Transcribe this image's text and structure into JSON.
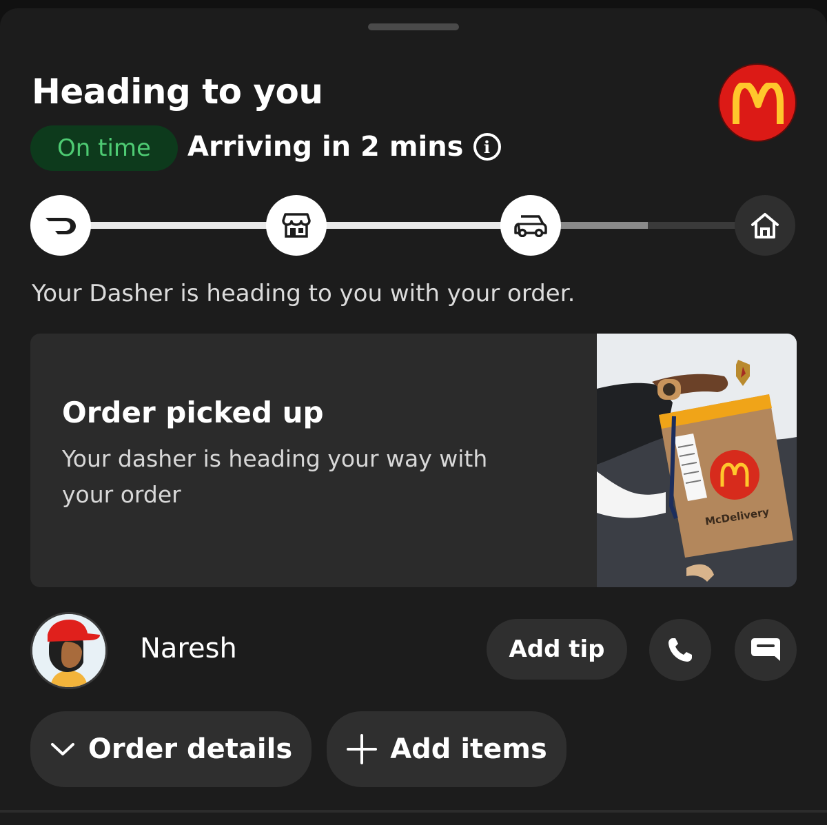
{
  "header": {
    "title": "Heading to you",
    "status_badge": "On time",
    "arrival_text": "Arriving in 2 mins",
    "restaurant_logo": "mcdonalds-logo"
  },
  "progress": {
    "steps": [
      "doordash-icon",
      "store-icon",
      "car-icon",
      "home-icon"
    ],
    "current_step": 3,
    "fraction_complete": 0.83
  },
  "status_description": "Your Dasher is heading to you with your order.",
  "card": {
    "title": "Order picked up",
    "subtitle": "Your dasher is heading your way with your order",
    "photo_text": {
      "bag_brand": "McDelivery"
    }
  },
  "dasher": {
    "name": "Naresh",
    "tip_label": "Add tip",
    "call_icon": "phone-icon",
    "message_icon": "chat-icon"
  },
  "actions": {
    "order_details_label": "Order details",
    "add_items_label": "Add items"
  },
  "colors": {
    "background": "#1c1c1c",
    "badge_bg": "#0d3a1c",
    "badge_text": "#4ecb73",
    "logo_red": "#dc1a16",
    "logo_yellow": "#ffc72c"
  }
}
